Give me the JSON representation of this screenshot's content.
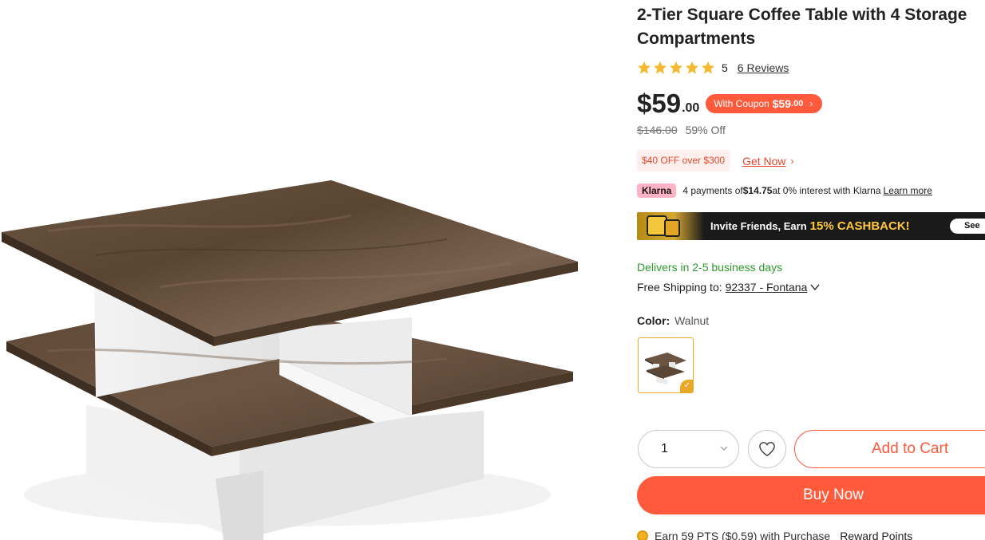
{
  "product": {
    "title": "2-Tier Square Coffee Table with 4 Storage Compartments",
    "image_alt_icon": "coffee-table-product-image",
    "rating": {
      "value": "5",
      "stars": 5,
      "reviews_label": "6 Reviews"
    },
    "price": {
      "symbol_dollars": "$59",
      "cents": ".00",
      "coupon_label": "With Coupon",
      "coupon_price": "$59",
      "coupon_cents": ".00",
      "coupon_chevron": "›",
      "old_price": "$146.00",
      "discount": "59% Off"
    },
    "promo": {
      "tag": "$40 OFF over $300",
      "link": "Get Now",
      "chevron": "›"
    },
    "klarna": {
      "logo": "Klarna",
      "text_prefix": "4 payments of ",
      "amount": "$14.75",
      "text_suffix": " at 0% interest with Klarna",
      "learn_more": "Learn more"
    },
    "cashback": {
      "text": "Invite Friends, Earn",
      "highlight": "15% CASHBACK!",
      "button": "See I"
    },
    "delivery": "Delivers in 2-5 business days",
    "shipping": {
      "label": "Free Shipping to:",
      "zip": "92337 - Fontana"
    },
    "color": {
      "label": "Color:",
      "value": "Walnut"
    },
    "quantity": "1",
    "actions": {
      "add_to_cart": "Add to Cart",
      "buy_now": "Buy Now"
    },
    "points": {
      "text": "Earn 59 PTS ($0.59) with Purchase",
      "link": "Reward Points"
    }
  },
  "colors": {
    "accent": "#ff5a3c",
    "star": "#f5b82e",
    "delivery_green": "#2c9a2c",
    "swatch_border": "#e9a825",
    "klarna_pink": "#ffb3c7"
  }
}
